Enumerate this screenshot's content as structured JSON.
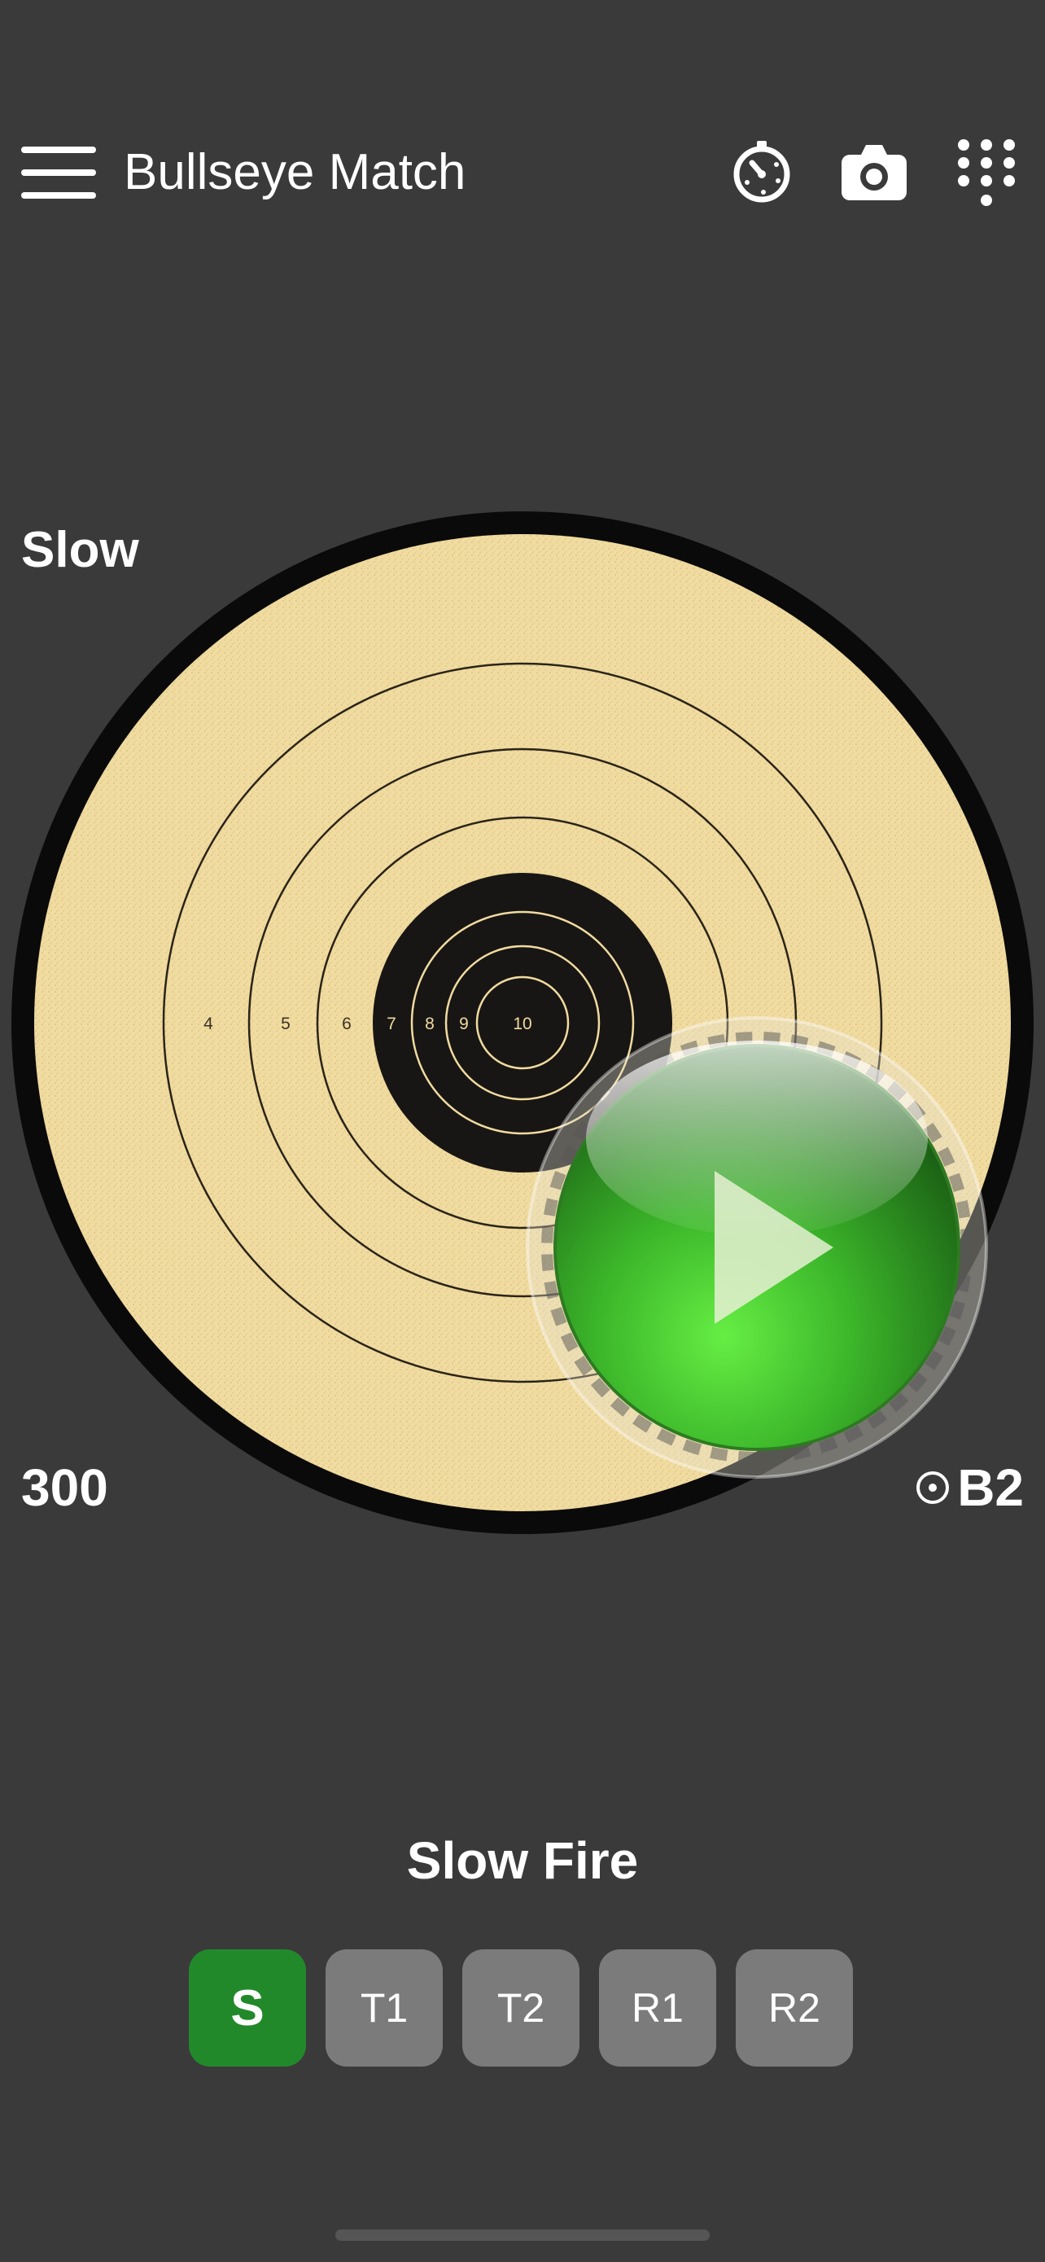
{
  "header": {
    "title": "Bullseye Match",
    "icons": [
      "menu-icon",
      "timer-icon",
      "camera-icon",
      "keypad-icon"
    ]
  },
  "target": {
    "stage_label": "Slow",
    "score": "300",
    "target_name": "B2",
    "target_icon": "target-dot-icon",
    "ring_numbers": [
      "4",
      "5",
      "6",
      "7",
      "8",
      "9",
      "10"
    ],
    "paper_color": "#f0dba0",
    "black_color": "#181614"
  },
  "play": {
    "icon": "play-icon",
    "color": "#3fa92a"
  },
  "mode": {
    "title": "Slow Fire",
    "stages": [
      {
        "label": "S",
        "active": true
      },
      {
        "label": "T1",
        "active": false
      },
      {
        "label": "T2",
        "active": false
      },
      {
        "label": "R1",
        "active": false
      },
      {
        "label": "R2",
        "active": false
      }
    ],
    "active_color": "#22892b",
    "inactive_color": "#7b7b7b"
  }
}
